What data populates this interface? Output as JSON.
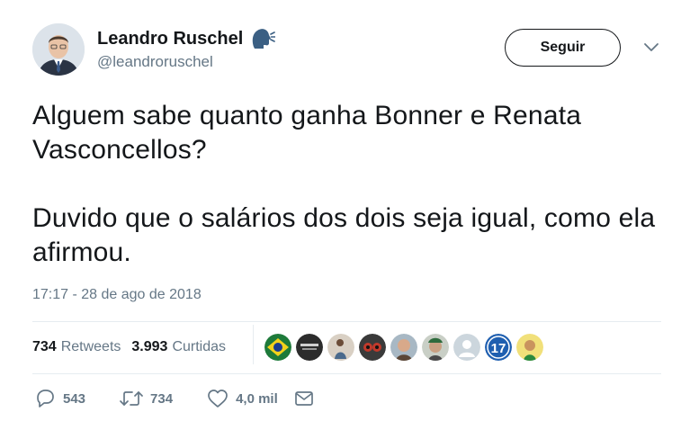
{
  "user": {
    "name": "Leandro Ruschel",
    "handle": "@leandroruschel"
  },
  "follow_button": {
    "label": "Seguir"
  },
  "tweet": {
    "paragraphs": [
      "Alguem sabe quanto ganha Bonner e Renata Vasconcellos?",
      "Duvido que o salários dos dois seja igual, como ela afirmou."
    ],
    "timestamp": "17:17 - 28 de ago de 2018"
  },
  "stats": {
    "retweets_count": "734",
    "retweets_label": "Retweets",
    "likes_count": "3.993",
    "likes_label": "Curtidas",
    "liker_badge_number": "17"
  },
  "actions": {
    "replies": "543",
    "retweets": "734",
    "likes": "4,0 mil"
  },
  "colors": {
    "text": "#14171a",
    "secondary": "#657786",
    "divider": "#e6ecf0",
    "speak_icon": "#3b5f83"
  },
  "icons": [
    "speaking-head-icon",
    "chevron-down-icon",
    "reply-icon",
    "retweet-icon",
    "heart-icon",
    "message-icon"
  ]
}
